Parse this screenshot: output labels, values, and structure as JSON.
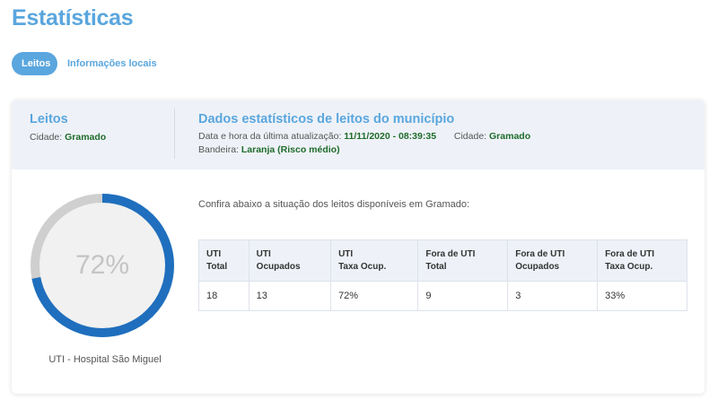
{
  "page": {
    "title": "Estatísticas"
  },
  "tabs": [
    {
      "label": "Leitos",
      "active": true
    },
    {
      "label": "Informações locais",
      "active": false
    }
  ],
  "header": {
    "left": {
      "title": "Leitos",
      "city_label": "Cidade:",
      "city_value": "Gramado"
    },
    "right": {
      "title": "Dados estatísticos de leitos do município",
      "updated_label": "Data e hora da última atualização:",
      "updated_value": "11/11/2020 - 08:39:35",
      "city_label": "Cidade:",
      "city_value": "Gramado",
      "flag_label": "Bandeira:",
      "flag_value": "Laranja (Risco médio)"
    }
  },
  "gauge": {
    "value_text": "72%",
    "fraction": 0.72,
    "caption": "UTI - Hospital São Miguel",
    "fill_color": "#1f6fbe",
    "track_color": "#cfcfcf"
  },
  "intro": "Confira abaixo a situação dos leitos disponíveis em Gramado:",
  "table": {
    "headers": [
      [
        "UTI",
        "Total"
      ],
      [
        "UTI",
        "Ocupados"
      ],
      [
        "UTI",
        "Taxa Ocup."
      ],
      [
        "Fora de UTI",
        "Total"
      ],
      [
        "Fora de UTI",
        "Ocupados"
      ],
      [
        "Fora de UTI",
        "Taxa Ocup."
      ]
    ],
    "row": [
      "18",
      "13",
      "72%",
      "9",
      "3",
      "33%"
    ]
  },
  "colors": {
    "accent": "#5aa6de",
    "highlight_text": "#1f6b2a"
  }
}
